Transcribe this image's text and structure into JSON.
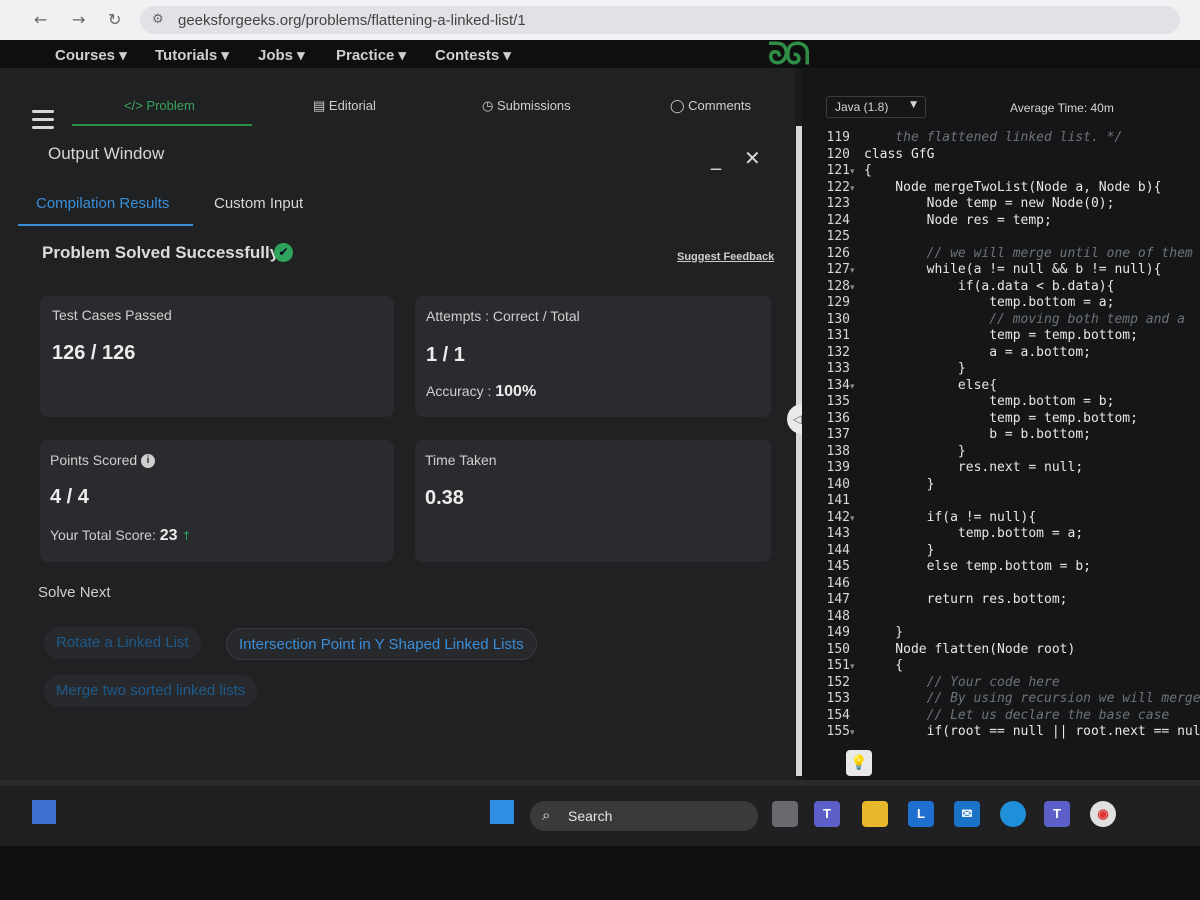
{
  "browser": {
    "url": "geeksforgeeks.org/problems/flattening-a-linked-list/1"
  },
  "site_nav": {
    "items": [
      "Courses",
      "Tutorials",
      "Jobs",
      "Practice",
      "Contests"
    ]
  },
  "problem_tabs": [
    {
      "label": "</> Problem",
      "active": true
    },
    {
      "label": "Editorial",
      "icon": "document-icon"
    },
    {
      "label": "Submissions",
      "icon": "clock-icon"
    },
    {
      "label": "Comments",
      "icon": "chat-bubble-icon"
    }
  ],
  "output_window": {
    "title": "Output Window",
    "minimize": "_",
    "close": "✕",
    "tabs": [
      "Compilation Results",
      "Custom Input"
    ],
    "status": "Problem Solved Successfully",
    "feedback_link": "Suggest Feedback"
  },
  "cards": {
    "test_cases": {
      "label": "Test Cases Passed",
      "value": "126 / 126"
    },
    "attempts": {
      "label": "Attempts : Correct / Total",
      "value": "1 / 1",
      "accuracy_label": "Accuracy :",
      "accuracy_value": "100%"
    },
    "points": {
      "label": "Points Scored",
      "value": "4 / 4",
      "total_label": "Your Total Score:",
      "total_value": "23"
    },
    "time": {
      "label": "Time Taken",
      "value": "0.38"
    }
  },
  "solve_next": {
    "heading": "Solve Next",
    "items": [
      "Rotate a Linked List",
      "Intersection Point in Y Shaped Linked Lists",
      "Merge two sorted linked lists"
    ]
  },
  "editor": {
    "language": "Java (1.8)",
    "avg_time": "Average Time: 40m",
    "lines": [
      {
        "n": "119",
        "fold": "",
        "text": "    the flattened linked list. */",
        "comment": true
      },
      {
        "n": "120",
        "fold": "",
        "text": "class GfG",
        "comment": false
      },
      {
        "n": "121",
        "fold": "▾",
        "text": "{",
        "comment": false
      },
      {
        "n": "122",
        "fold": "▾",
        "text": "    Node mergeTwoList(Node a, Node b){",
        "comment": false
      },
      {
        "n": "123",
        "fold": "",
        "text": "        Node temp = new Node(0);",
        "comment": false
      },
      {
        "n": "124",
        "fold": "",
        "text": "        Node res = temp;",
        "comment": false
      },
      {
        "n": "125",
        "fold": "",
        "text": "",
        "comment": false
      },
      {
        "n": "126",
        "fold": "",
        "text": "        // we will merge until one of them",
        "comment": true
      },
      {
        "n": "127",
        "fold": "▾",
        "text": "        while(a != null && b != null){",
        "comment": false
      },
      {
        "n": "128",
        "fold": "▾",
        "text": "            if(a.data < b.data){",
        "comment": false
      },
      {
        "n": "129",
        "fold": "",
        "text": "                temp.bottom = a;",
        "comment": false
      },
      {
        "n": "130",
        "fold": "",
        "text": "                // moving both temp and a",
        "comment": true
      },
      {
        "n": "131",
        "fold": "",
        "text": "                temp = temp.bottom;",
        "comment": false
      },
      {
        "n": "132",
        "fold": "",
        "text": "                a = a.bottom;",
        "comment": false
      },
      {
        "n": "133",
        "fold": "",
        "text": "            }",
        "comment": false
      },
      {
        "n": "134",
        "fold": "▾",
        "text": "            else{",
        "comment": false
      },
      {
        "n": "135",
        "fold": "",
        "text": "                temp.bottom = b;",
        "comment": false
      },
      {
        "n": "136",
        "fold": "",
        "text": "                temp = temp.bottom;",
        "comment": false
      },
      {
        "n": "137",
        "fold": "",
        "text": "                b = b.bottom;",
        "comment": false
      },
      {
        "n": "138",
        "fold": "",
        "text": "            }",
        "comment": false
      },
      {
        "n": "139",
        "fold": "",
        "text": "            res.next = null;",
        "comment": false
      },
      {
        "n": "140",
        "fold": "",
        "text": "        }",
        "comment": false
      },
      {
        "n": "141",
        "fold": "",
        "text": "",
        "comment": false
      },
      {
        "n": "142",
        "fold": "▾",
        "text": "        if(a != null){",
        "comment": false
      },
      {
        "n": "143",
        "fold": "",
        "text": "            temp.bottom = a;",
        "comment": false
      },
      {
        "n": "144",
        "fold": "",
        "text": "        }",
        "comment": false
      },
      {
        "n": "145",
        "fold": "",
        "text": "        else temp.bottom = b;",
        "comment": false
      },
      {
        "n": "146",
        "fold": "",
        "text": "",
        "comment": false
      },
      {
        "n": "147",
        "fold": "",
        "text": "        return res.bottom;",
        "comment": false
      },
      {
        "n": "148",
        "fold": "",
        "text": "",
        "comment": false
      },
      {
        "n": "149",
        "fold": "",
        "text": "    }",
        "comment": false
      },
      {
        "n": "150",
        "fold": "",
        "text": "    Node flatten(Node root)",
        "comment": false
      },
      {
        "n": "151",
        "fold": "▾",
        "text": "    {",
        "comment": false
      },
      {
        "n": "152",
        "fold": "",
        "text": "        // Your code here",
        "comment": true
      },
      {
        "n": "153",
        "fold": "",
        "text": "        // By using recursion we will merge",
        "comment": true
      },
      {
        "n": "154",
        "fold": "",
        "text": "        // Let us declare the base case",
        "comment": true
      },
      {
        "n": "155",
        "fold": "▾",
        "text": "        if(root == null || root.next == null",
        "comment": false
      }
    ]
  },
  "taskbar": {
    "search_label": "Search",
    "outlook_letter": "L"
  }
}
